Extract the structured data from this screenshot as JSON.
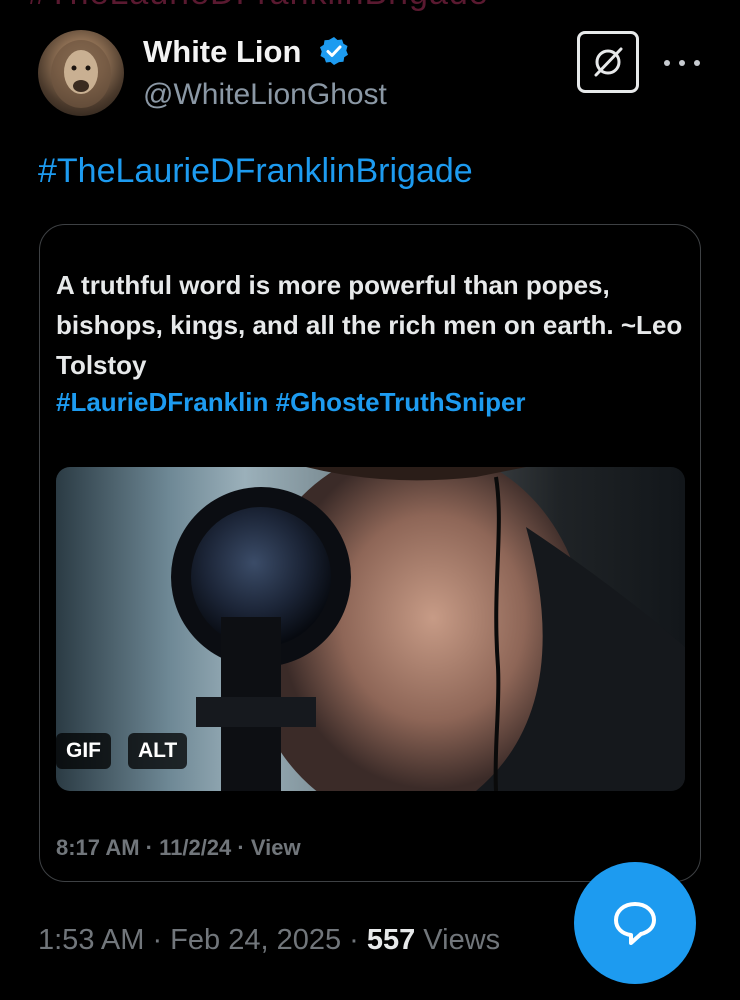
{
  "top_partial_hashtag": "#TheLaurieDFranklinBrigade",
  "author": {
    "name": "White Lion",
    "handle": "@WhiteLionGhost",
    "avatar_icon": "lion-avatar",
    "verified_icon": "verified-badge-icon",
    "verified_color": "#1d9bf0"
  },
  "header_actions": {
    "grok_icon": "grok-icon",
    "more_icon": "more-horizontal-icon"
  },
  "post": {
    "hashtag": "#TheLaurieDFranklinBrigade",
    "timestamp": "1:53 AM · Feb 24, 2025 · ",
    "views_count": "557",
    "views_label": " Views"
  },
  "quote": {
    "text": "A truthful word is more powerful than popes, bishops, kings, and all the rich men on earth. ~Leo Tolstoy",
    "hashtags": "#LaurieDFranklin #GhosteTruthSniper",
    "media_badges": {
      "gif": "GIF",
      "alt": "ALT"
    },
    "meta": "8:17 AM · 11/2/24 · View"
  },
  "fab": {
    "icon": "reply-bubble-icon"
  },
  "colors": {
    "accent": "#1d9bf0",
    "background": "#000000",
    "muted": "#71767b"
  }
}
